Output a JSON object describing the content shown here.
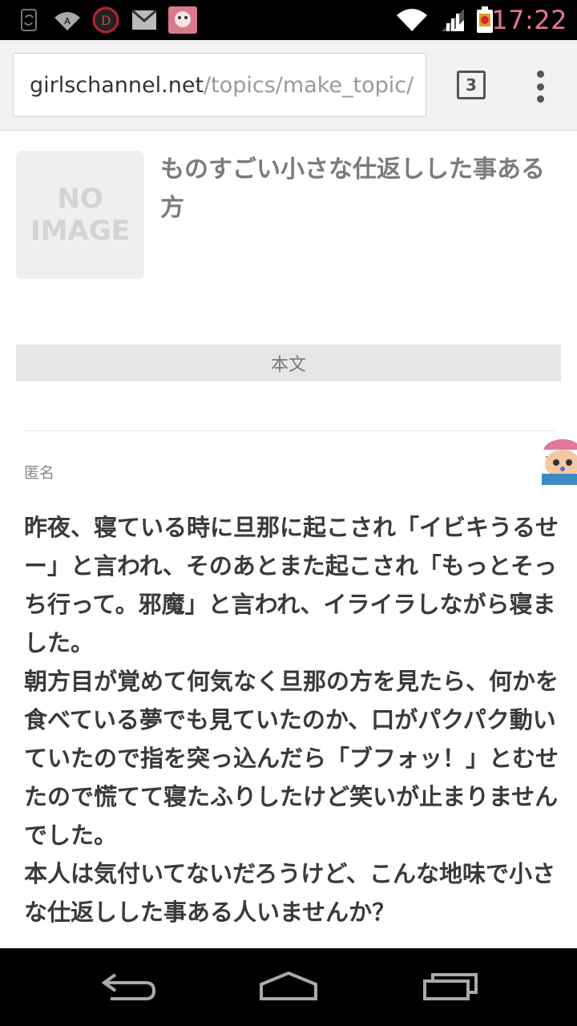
{
  "status_bar": {
    "time": "17:22",
    "icons": [
      "sync-icon",
      "wifi-signal-app-icon",
      "disney-app-icon",
      "gmail-icon",
      "character-app-icon",
      "wifi-icon",
      "cell-signal-icon",
      "battery-icon"
    ]
  },
  "browser": {
    "url_host": "girlschannel.net",
    "url_path": "/topics/make_topic/",
    "tab_count": "3"
  },
  "topic": {
    "no_image_line1": "NO",
    "no_image_line2": "IMAGE",
    "title": "ものすごい小さな仕返しした事ある方"
  },
  "section": {
    "label": "本文"
  },
  "post": {
    "author": "匿名",
    "body_lines": [
      "昨夜、寝ている時に旦那に起こされ「イビキうるせー」と言われ、そのあとまた起こされ「もっとそっち行って。邪魔」と言われ、イライラしながら寝ました。",
      "朝方目が覚めて何気なく旦那の方を見たら、何かを食べている夢でも見ていたのか、口がパクパク動いていたので指を突っ込んだら「ブフォッ！」とむせたので慌てて寝たふりしたけど笑いが止まりませんでした。",
      "本人は気付いてないだろうけど、こんな地味で小さな仕返しした事ある人いませんか？"
    ]
  },
  "colors": {
    "status_time": "#e8739a",
    "title_text": "#7b7b7b",
    "body_text": "#3a3a3a"
  }
}
